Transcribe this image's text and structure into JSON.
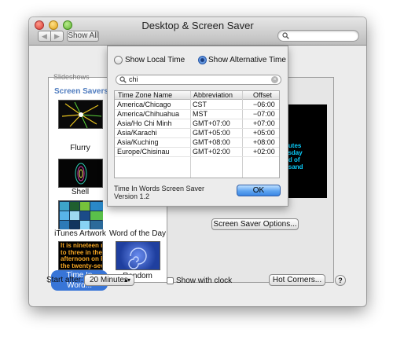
{
  "window": {
    "title": "Desktop & Screen Saver"
  },
  "toolbar": {
    "back": "◀",
    "forward": "▶",
    "show_all": "Show All",
    "search_placeholder": ""
  },
  "left_list": {
    "cut_header": "Slideshows",
    "section_header": "Screen Savers",
    "items": [
      {
        "label": "Flurry"
      },
      {
        "label": "Shell"
      },
      {
        "label": "iTunes Artwork"
      },
      {
        "label": "Word of the Day"
      },
      {
        "label": "Time In Word...",
        "selected": true
      },
      {
        "label": "Random"
      }
    ],
    "thumb_text": [
      "It is nineteen m",
      "to three in the",
      "afternoon on F",
      "the twenty-sev"
    ]
  },
  "preview": {
    "lines": [
      "nutes",
      "esday",
      "nd of",
      "usand"
    ]
  },
  "buttons": {
    "screen_saver_options": "Screen Saver Options...",
    "hot_corners": "Hot Corners...",
    "help": "?"
  },
  "bottom": {
    "start_after_label": "Start after:",
    "start_after_value": "20 Minutes",
    "show_clock_label": "Show with clock",
    "show_clock_checked": false
  },
  "sheet": {
    "radio_local": "Show Local Time",
    "radio_alt": "Show Alternative Time",
    "selected_radio": "alternative",
    "search_value": "chi",
    "columns": [
      "Time Zone Name",
      "Abbreviation",
      "Offset"
    ],
    "rows": [
      {
        "name": "America/Chicago",
        "abbr": "CST",
        "offset": "−06:00"
      },
      {
        "name": "America/Chihuahua",
        "abbr": "MST",
        "offset": "−07:00"
      },
      {
        "name": "Asia/Ho Chi Minh",
        "abbr": "GMT+07:00",
        "offset": "+07:00"
      },
      {
        "name": "Asia/Karachi",
        "abbr": "GMT+05:00",
        "offset": "+05:00"
      },
      {
        "name": "Asia/Kuching",
        "abbr": "GMT+08:00",
        "offset": "+08:00"
      },
      {
        "name": "Europe/Chisinau",
        "abbr": "GMT+02:00",
        "offset": "+02:00"
      }
    ],
    "app_name": "Time In Words Screen Saver",
    "version": "Version 1.2",
    "ok": "OK"
  },
  "colors": {
    "selection": "#3875d7",
    "section_header": "#4f7cbf",
    "preview_text": "#0ad0ff"
  },
  "icons": [
    "search-icon",
    "back-arrow-icon",
    "forward-arrow-icon",
    "clear-icon",
    "popup-arrows-icon"
  ]
}
